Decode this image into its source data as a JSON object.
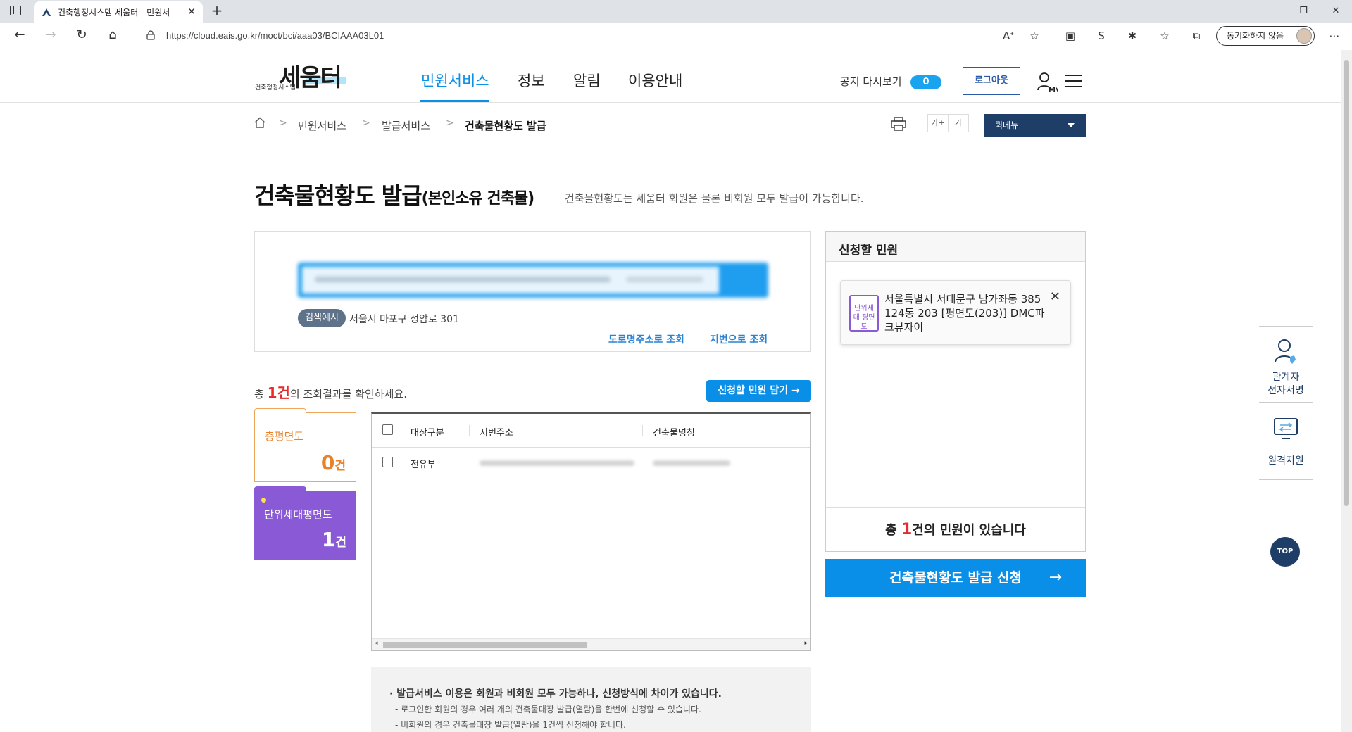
{
  "browser": {
    "tab_title": "건축행정시스템 세움터 - 민원서",
    "url": "https://cloud.eais.go.kr/moct/bci/aaa03/BCIAAA03L01",
    "sync_label": "동기화하지 않음",
    "new_tab_label": "+",
    "tab_close": "✕"
  },
  "header": {
    "logo_main": "세움터",
    "logo_sub": "건축행정시스템",
    "nav": [
      "민원서비스",
      "정보",
      "알림",
      "이용안내"
    ],
    "notice_label": "공지 다시보기",
    "notice_count": "0",
    "logout_label": "로그아웃",
    "my_label": "My"
  },
  "breadcrumb": {
    "items": [
      "민원서비스",
      "발급서비스",
      "건축물현황도 발급"
    ],
    "font_larger": "가+",
    "font_normal": "가",
    "quick_menu": "퀵메뉴"
  },
  "page": {
    "title": "건축물현황도 발급",
    "title_suffix": "(본인소유 건축물)",
    "description": "건축물현황도는 세움터 회원은 물론 비회원 모두 발급이 가능합니다."
  },
  "search": {
    "example_tag": "검색예시",
    "example_text": "서울시 마포구 성암로 301",
    "road_link": "도로명주소로 조회",
    "lot_link": "지번으로 조회"
  },
  "results": {
    "summary_prefix": "총 ",
    "count": "1건",
    "summary_suffix": "의 조회결과를 확인하세요.",
    "add_button": "신청할 민원 담기 →",
    "cards": {
      "floor_label": "층평면도",
      "floor_count": "0",
      "unit_label": "단위세대평면도",
      "unit_count": "1",
      "unit_suffix": "건"
    },
    "table": {
      "headers": [
        "대장구분",
        "지번주소",
        "건축물명칭"
      ],
      "rows": [
        {
          "type": "전유부"
        }
      ]
    }
  },
  "notice": {
    "heading": "· 발급서비스 이용은 회원과 비회원 모두 가능하나, 신청방식에 차이가 있습니다.",
    "lines": [
      "- 로그인한 회원의 경우 여러 개의 건축물대장 발급(열람)을 한번에 신청할 수 있습니다.",
      "- 비회원의 경우 건축물대장 발급(열람)을 1건씩 신청해야 합니다."
    ]
  },
  "apply": {
    "title": "신청할 민원",
    "item_doc_label": "단위세대 평면도",
    "item_address": "서울특별시 서대문구 남가좌동 385 124동 203 [평면도(203)] DMC파크뷰자이",
    "total_prefix": "총 ",
    "total_count": "1",
    "total_suffix": "건의 민원이 있습니다",
    "submit_label": "건축물현황도 발급 신청",
    "submit_arrow": "→"
  },
  "quick_nav": {
    "signature_label": "관계자\n전자서명",
    "remote_label": "원격지원",
    "top_label": "TOP"
  },
  "colors": {
    "accent": "#0a8fe8",
    "navy": "#1e3e68",
    "purple": "#8a5ad6",
    "orange": "#e8812a",
    "red": "#e52b2b"
  }
}
